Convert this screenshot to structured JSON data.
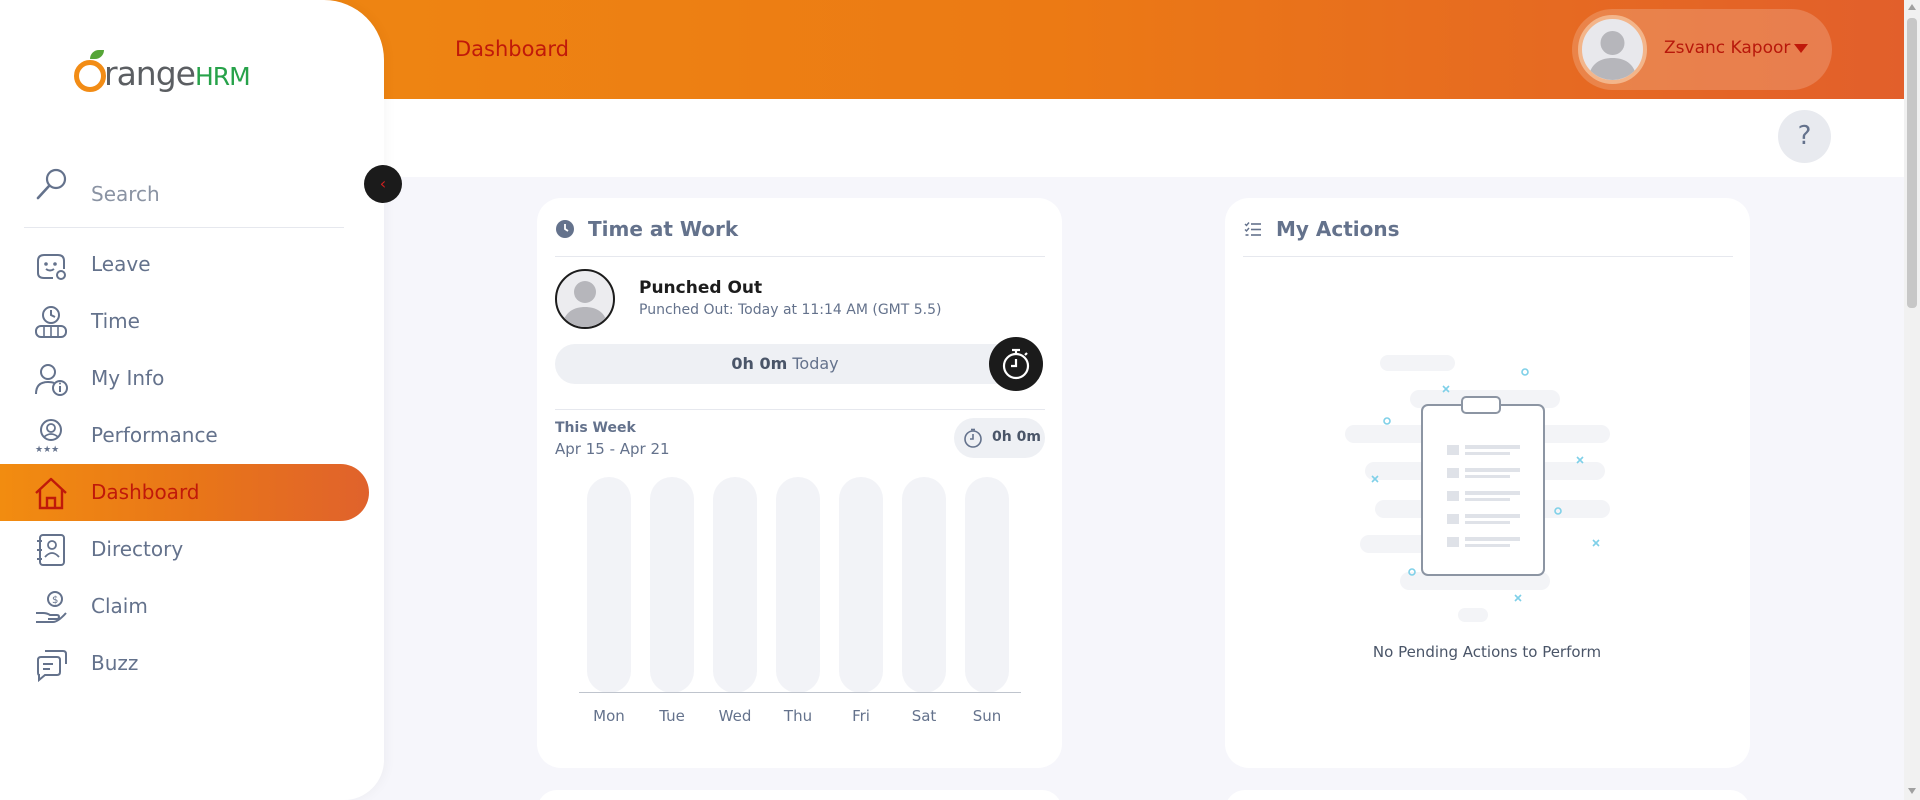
{
  "header": {
    "title": "Dashboard",
    "user_name": "Zsvanc Kapoor"
  },
  "help": {
    "label": "?"
  },
  "sidebar": {
    "logo_text": "range",
    "logo_hrm": "HRM",
    "search_placeholder": "Search",
    "items": [
      {
        "label": "Leave",
        "icon": "leave-icon"
      },
      {
        "label": "Time",
        "icon": "time-icon"
      },
      {
        "label": "My Info",
        "icon": "my-info-icon"
      },
      {
        "label": "Performance",
        "icon": "performance-icon"
      },
      {
        "label": "Dashboard",
        "icon": "home-icon",
        "active": true
      },
      {
        "label": "Directory",
        "icon": "directory-icon"
      },
      {
        "label": "Claim",
        "icon": "claim-icon"
      },
      {
        "label": "Buzz",
        "icon": "buzz-icon"
      }
    ],
    "collapse_glyph": "‹"
  },
  "time_at_work": {
    "title": "Time at Work",
    "status": "Punched Out",
    "status_detail": "Punched Out: Today at 11:14 AM (GMT 5.5)",
    "today_total": "0h 0m",
    "today_label": "Today",
    "week_label": "This Week",
    "week_range": "Apr 15 - Apr 21",
    "week_total": "0h 0m",
    "chart_data": {
      "type": "bar",
      "categories": [
        "Mon",
        "Tue",
        "Wed",
        "Thu",
        "Fri",
        "Sat",
        "Sun"
      ],
      "values": [
        0,
        0,
        0,
        0,
        0,
        0,
        0
      ]
    }
  },
  "my_actions": {
    "title": "My Actions",
    "empty_message": "No Pending Actions to Perform"
  },
  "colors": {
    "brand_orange": "#ef8a11",
    "accent_red": "#c0190a",
    "text_muted": "#64728c"
  }
}
